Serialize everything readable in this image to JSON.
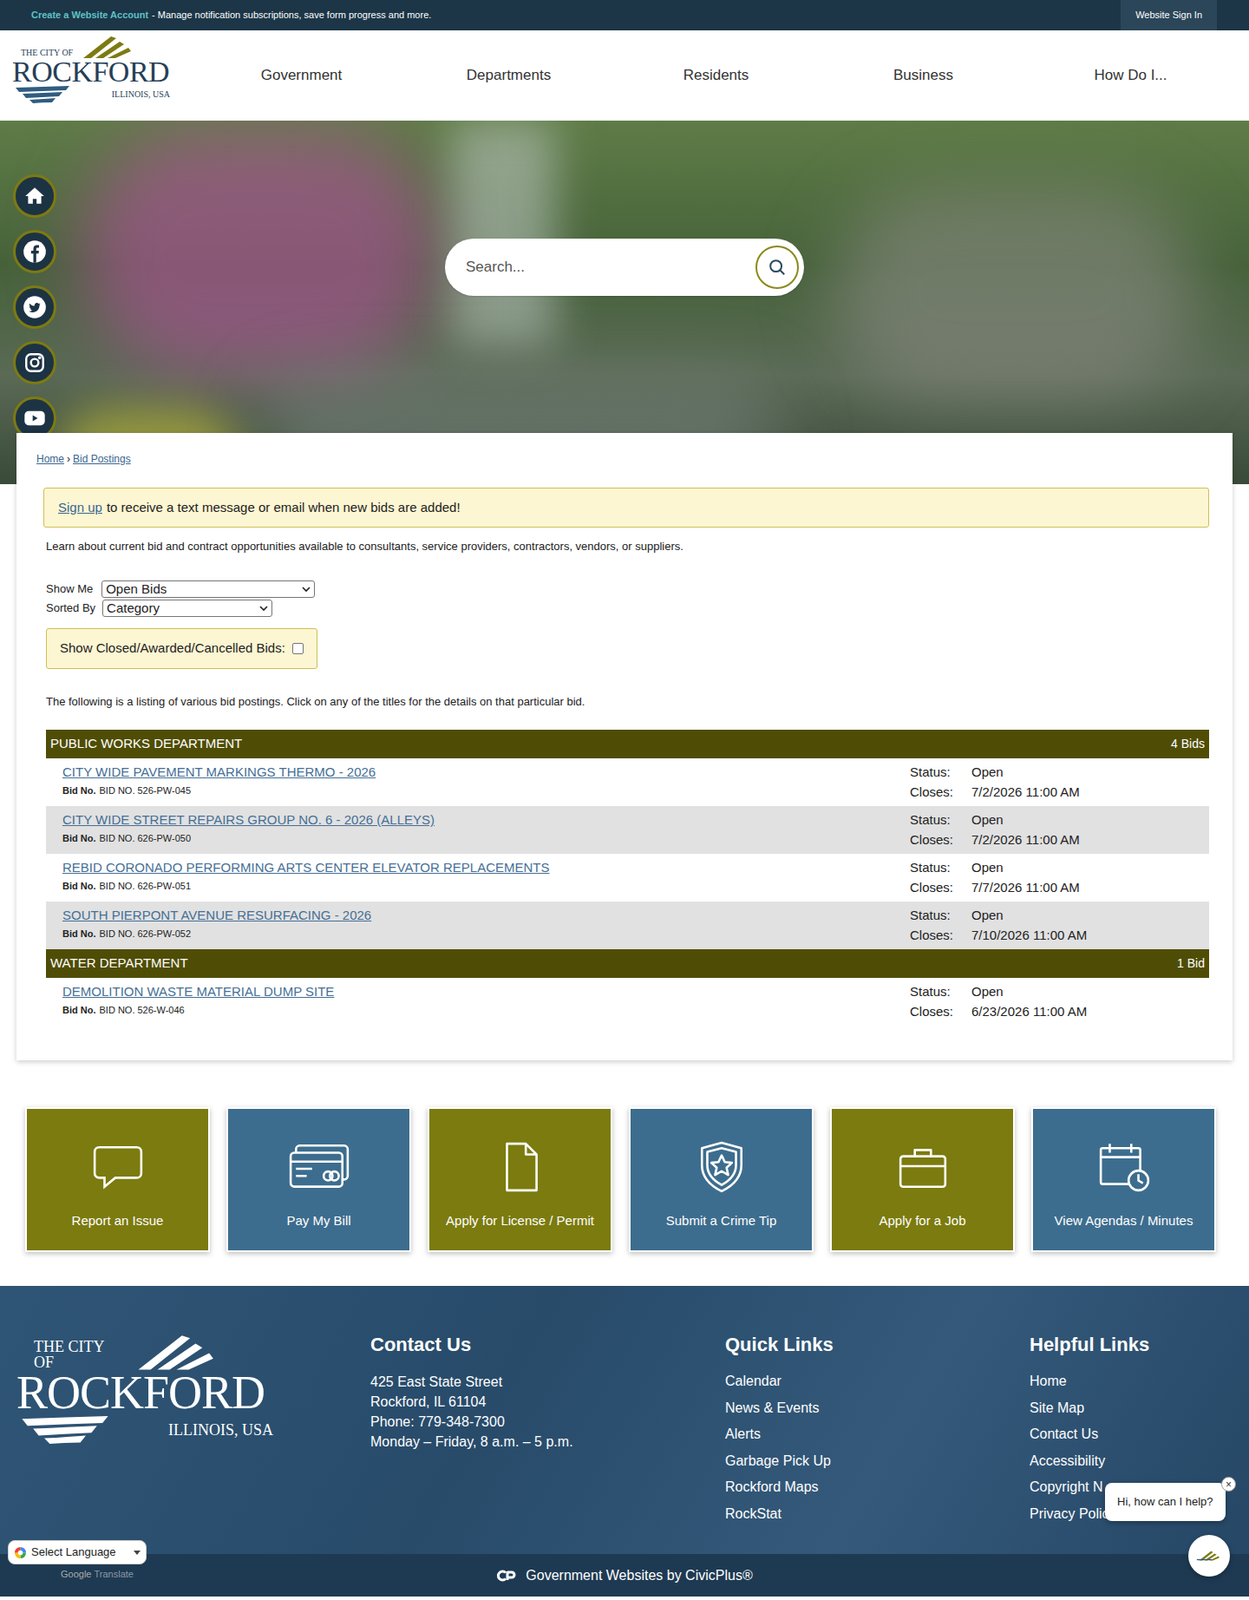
{
  "top_bar": {
    "link": "Create a Website Account",
    "text": "- Manage notification subscriptions, save form progress and more.",
    "sign_in": "Website Sign In"
  },
  "logo": {
    "prefix": "THE CITY OF",
    "name": "ROCKFORD",
    "suffix": "ILLINOIS, USA"
  },
  "nav": [
    "Government",
    "Departments",
    "Residents",
    "Business",
    "How Do I..."
  ],
  "search": {
    "placeholder": "Search..."
  },
  "breadcrumb": {
    "home": "Home",
    "separator": "›",
    "current": "Bid Postings"
  },
  "notice": {
    "link": "Sign up",
    "text": "to receive a text message or email when new bids are added!"
  },
  "intro": "Learn about current bid and contract opportunities available to consultants, service providers, contractors, vendors, or suppliers.",
  "filters": {
    "show_me": {
      "label": "Show Me",
      "value": "Open Bids"
    },
    "sorted_by": {
      "label": "Sorted By",
      "value": "Category"
    },
    "show_closed": {
      "label": "Show Closed/Awarded/Cancelled Bids:",
      "checked": false
    }
  },
  "listing_note": "The following is a listing of various bid postings. Click on any of the titles for the details on that particular bid.",
  "labels": {
    "bid_no": "Bid No.",
    "status": "Status:",
    "closes": "Closes:"
  },
  "categories": [
    {
      "name": "PUBLIC WORKS DEPARTMENT",
      "count": "4 Bids",
      "bids": [
        {
          "title": "CITY WIDE PAVEMENT MARKINGS THERMO - 2026",
          "bid_no": "BID NO. 526-PW-045",
          "status": "Open",
          "closes": "7/2/2026 11:00 AM"
        },
        {
          "title": "CITY WIDE STREET REPAIRS GROUP NO. 6 - 2026 (ALLEYS)",
          "bid_no": "BID NO. 626-PW-050",
          "status": "Open",
          "closes": "7/2/2026 11:00 AM"
        },
        {
          "title": "REBID CORONADO PERFORMING ARTS CENTER ELEVATOR REPLACEMENTS",
          "bid_no": "BID NO. 626-PW-051",
          "status": "Open",
          "closes": "7/7/2026 11:00 AM"
        },
        {
          "title": "SOUTH PIERPONT AVENUE RESURFACING - 2026",
          "bid_no": "BID NO. 626-PW-052",
          "status": "Open",
          "closes": "7/10/2026 11:00 AM"
        }
      ]
    },
    {
      "name": "WATER DEPARTMENT",
      "count": "1 Bid",
      "bids": [
        {
          "title": "DEMOLITION WASTE MATERIAL DUMP SITE",
          "bid_no": "BID NO. 526-W-046",
          "status": "Open",
          "closes": "6/23/2026 11:00 AM"
        }
      ]
    }
  ],
  "tiles": [
    {
      "label": "Report an Issue",
      "color": "#7b7b0f"
    },
    {
      "label": "Pay My Bill",
      "color": "#3d6d8e"
    },
    {
      "label": "Apply for License / Permit",
      "color": "#7b7b0f"
    },
    {
      "label": "Submit a Crime Tip",
      "color": "#3d6d8e"
    },
    {
      "label": "Apply for a Job",
      "color": "#7b7b0f"
    },
    {
      "label": "View Agendas / Minutes",
      "color": "#3d6d8e"
    }
  ],
  "footer": {
    "contact": {
      "heading": "Contact Us",
      "lines": [
        "425 East State Street",
        "Rockford, IL 61104",
        "Phone: 779-348-7300",
        "Monday – Friday, 8 a.m. – 5 p.m."
      ]
    },
    "quick_links": {
      "heading": "Quick Links",
      "items": [
        "Calendar",
        "News & Events",
        "Alerts",
        "Garbage Pick Up",
        "Rockford Maps",
        "RockStat"
      ]
    },
    "helpful_links": {
      "heading": "Helpful Links",
      "items": [
        "Home",
        "Site Map",
        "Contact Us",
        "Accessibility",
        "Copyright N",
        "Privacy Polic"
      ]
    }
  },
  "chat": {
    "greeting": "Hi, how can I help?",
    "close": "×"
  },
  "translate": {
    "label": "Select Language",
    "brand": "Google",
    "product": "Translate"
  },
  "credit": "Government Websites by CivicPlus®"
}
